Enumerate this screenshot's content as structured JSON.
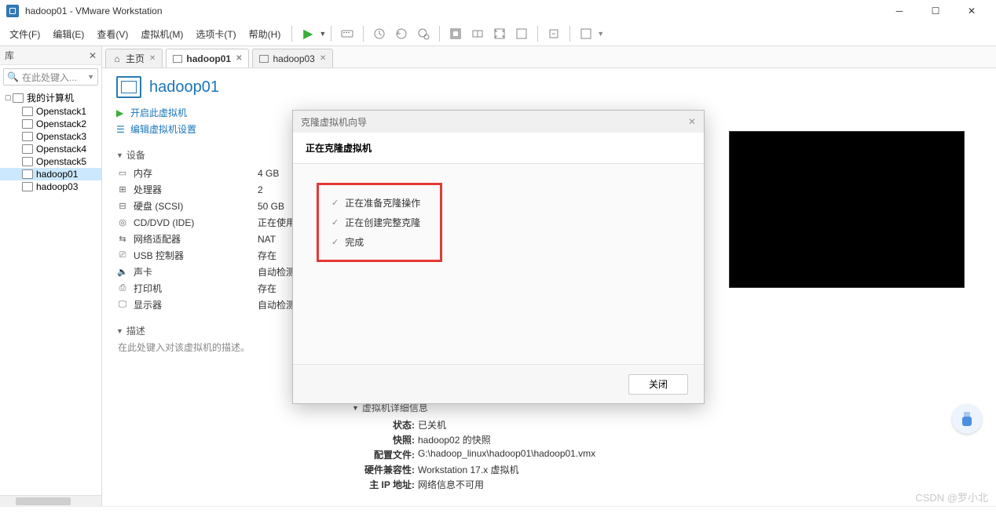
{
  "title": "hadoop01 - VMware Workstation",
  "menu": [
    "文件(F)",
    "编辑(E)",
    "查看(V)",
    "虚拟机(M)",
    "选项卡(T)",
    "帮助(H)"
  ],
  "library": {
    "header": "库",
    "search_placeholder": "在此处键入...",
    "root": "我的计算机",
    "items": [
      "Openstack1",
      "Openstack2",
      "Openstack3",
      "Openstack4",
      "Openstack5",
      "hadoop01",
      "hadoop03"
    ],
    "selected": "hadoop01"
  },
  "tabs": {
    "home": "主页",
    "items": [
      "hadoop01",
      "hadoop03"
    ],
    "active": "hadoop01"
  },
  "vm": {
    "name": "hadoop01",
    "actions": {
      "power": "开启此虚拟机",
      "edit": "编辑虚拟机设置"
    },
    "devices_header": "设备",
    "devices": [
      {
        "icon": "mem",
        "label": "内存",
        "value": "4 GB"
      },
      {
        "icon": "cpu",
        "label": "处理器",
        "value": "2"
      },
      {
        "icon": "hdd",
        "label": "硬盘 (SCSI)",
        "value": "50 GB"
      },
      {
        "icon": "cd",
        "label": "CD/DVD (IDE)",
        "value": "正在使用"
      },
      {
        "icon": "net",
        "label": "网络适配器",
        "value": "NAT"
      },
      {
        "icon": "usb",
        "label": "USB 控制器",
        "value": "存在"
      },
      {
        "icon": "snd",
        "label": "声卡",
        "value": "自动检测"
      },
      {
        "icon": "prn",
        "label": "打印机",
        "value": "存在"
      },
      {
        "icon": "dsp",
        "label": "显示器",
        "value": "自动检测"
      }
    ],
    "desc_header": "描述",
    "desc_placeholder": "在此处键入对该虚拟机的描述。"
  },
  "details": {
    "header": "虚拟机详细信息",
    "rows": [
      {
        "k": "状态:",
        "v": "已关机"
      },
      {
        "k": "快照:",
        "v": "hadoop02 的快照"
      },
      {
        "k": "配置文件:",
        "v": "G:\\hadoop_linux\\hadoop01\\hadoop01.vmx"
      },
      {
        "k": "硬件兼容性:",
        "v": "Workstation 17.x 虚拟机"
      },
      {
        "k": "主 IP 地址:",
        "v": "网络信息不可用"
      }
    ]
  },
  "dialog": {
    "title": "克隆虚拟机向导",
    "subtitle": "正在克隆虚拟机",
    "steps": [
      "正在准备克隆操作",
      "正在创建完整克隆",
      "完成"
    ],
    "close_btn": "关闭"
  },
  "watermark": "CSDN @罗小北"
}
